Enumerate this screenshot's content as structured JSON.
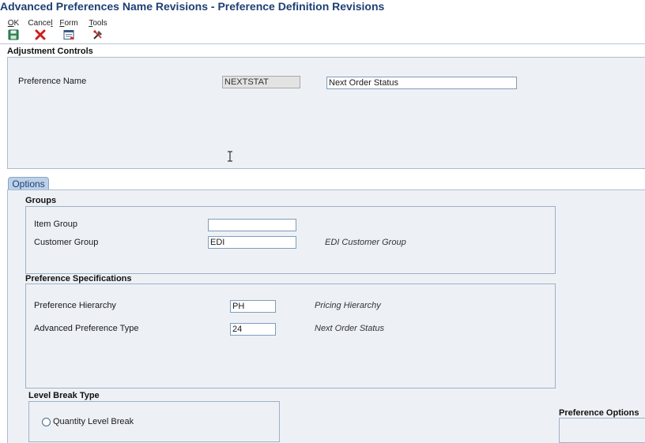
{
  "window": {
    "title": "Advanced Preferences Name Revisions - Preference Definition Revisions"
  },
  "toolbar": {
    "ok": {
      "prefix": "",
      "ul": "O",
      "rest": "K",
      "icon": "save-icon"
    },
    "cancel": {
      "prefix": "Cance",
      "ul": "l",
      "rest": "",
      "icon": "close-icon"
    },
    "form": {
      "prefix": "",
      "ul": "F",
      "rest": "orm",
      "icon": "form-icon"
    },
    "tools": {
      "prefix": "",
      "ul": "T",
      "rest": "ools",
      "icon": "tools-icon"
    }
  },
  "adjustment_controls": {
    "header": "Adjustment Controls",
    "preference_name_label": "Preference Name",
    "preference_name_code": "NEXTSTAT",
    "preference_name_desc": "Next Order Status"
  },
  "tabs": {
    "options": "Options"
  },
  "groups": {
    "header": "Groups",
    "item_group_label": "Item Group",
    "item_group_value": "",
    "customer_group_label": "Customer Group",
    "customer_group_value": "EDI",
    "customer_group_desc": "EDI Customer Group"
  },
  "preference_specifications": {
    "header": "Preference Specifications",
    "hierarchy_label": "Preference Hierarchy",
    "hierarchy_value": "PH",
    "hierarchy_desc": "Pricing Hierarchy",
    "type_label": "Advanced Preference Type",
    "type_value": "24",
    "type_desc": "Next Order Status"
  },
  "level_break": {
    "header": "Level Break Type",
    "quantity_label": "Quantity Level Break"
  },
  "preference_options": {
    "header": "Preference Options"
  },
  "colors": {
    "title": "#1e3f74",
    "panel": "#edf1f6",
    "border": "#9fb0c4",
    "cancel_x": "#cc1f1f"
  }
}
